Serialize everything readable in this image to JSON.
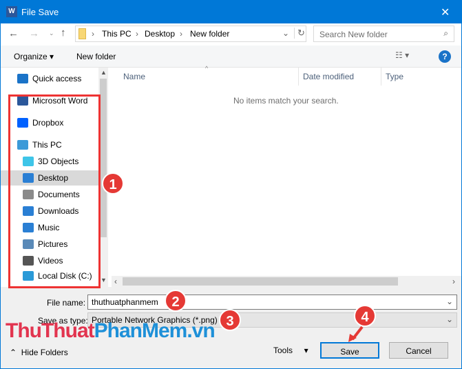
{
  "window": {
    "title": "File Save",
    "close": "✕"
  },
  "address": {
    "crumbs": [
      "This PC",
      "Desktop",
      "New folder"
    ],
    "search_placeholder": "Search New folder"
  },
  "toolbar": {
    "organize": "Organize",
    "new_folder": "New folder",
    "help": "?"
  },
  "nav": {
    "items": [
      {
        "label": "Quick access",
        "icon": "star-icon",
        "color": "#1a73c8"
      },
      {
        "label": "Microsoft Word",
        "icon": "word-icon",
        "color": "#2b579a"
      },
      {
        "label": "Dropbox",
        "icon": "dropbox-icon",
        "color": "#0061ff"
      },
      {
        "label": "This PC",
        "icon": "computer-icon",
        "color": "#3c9ad8"
      },
      {
        "label": "3D Objects",
        "icon": "cube-icon",
        "color": "#3ec5e8"
      },
      {
        "label": "Desktop",
        "icon": "desktop-icon",
        "color": "#2a7fd4"
      },
      {
        "label": "Documents",
        "icon": "document-icon",
        "color": "#8a8a8a"
      },
      {
        "label": "Downloads",
        "icon": "download-icon",
        "color": "#2a7fd4"
      },
      {
        "label": "Music",
        "icon": "music-icon",
        "color": "#2a7fd4"
      },
      {
        "label": "Pictures",
        "icon": "pictures-icon",
        "color": "#5a8ab8"
      },
      {
        "label": "Videos",
        "icon": "videos-icon",
        "color": "#555555"
      },
      {
        "label": "Local Disk (C:)",
        "icon": "disk-icon",
        "color": "#2a9ad8"
      }
    ]
  },
  "columns": [
    "Name",
    "Date modified",
    "Type"
  ],
  "empty_message": "No items match your search.",
  "form": {
    "file_name_label": "File name:",
    "file_name": "thuthuatphanmem",
    "type_label": "Save as type:",
    "type": "Portable Network Graphics (*.png)"
  },
  "footer": {
    "hide_folders": "Hide Folders",
    "tools": "Tools",
    "save": "Save",
    "cancel": "Cancel"
  },
  "badges": [
    "1",
    "2",
    "3",
    "4"
  ],
  "watermark": {
    "part1": "ThuThuat",
    "part2": "PhanMem.vn"
  },
  "colors": {
    "accent": "#0078d7",
    "annotation": "#e53935"
  }
}
